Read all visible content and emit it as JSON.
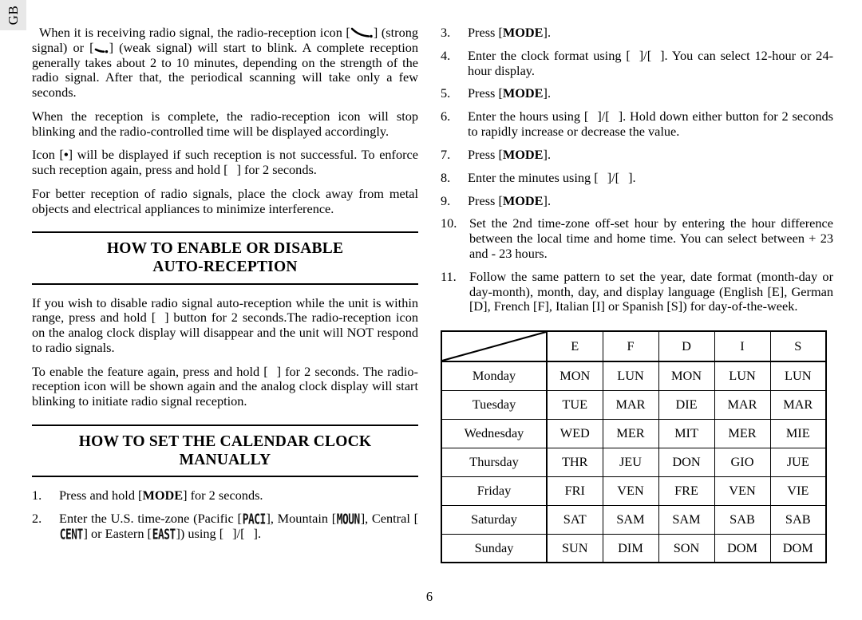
{
  "language_tab": {
    "label": "GB"
  },
  "page_number": "6",
  "left_column": {
    "paragraphs": [
      {
        "id": "p-receiving-signal",
        "segments": [
          {
            "type": "text",
            "text": "When it is receiving radio signal, the radio-reception icon ["
          },
          {
            "type": "icon",
            "name": "signal-strong-icon"
          },
          {
            "type": "text",
            "text": "] (strong signal) or ["
          },
          {
            "type": "icon",
            "name": "signal-weak-icon"
          },
          {
            "type": "text",
            "text": "] (weak signal) will start to blink. A complete reception generally takes about 2 to 10 minutes, depending on the strength of the radio signal. After that, the periodical scanning will take only a few seconds."
          }
        ]
      },
      {
        "id": "p-reception-complete",
        "segments": [
          {
            "type": "text",
            "text": "When the reception is complete, the radio-reception icon will stop blinking and the radio-controlled time will be displayed accordingly."
          }
        ]
      },
      {
        "id": "p-icon-dot",
        "segments": [
          {
            "type": "text",
            "text": "Icon ["
          },
          {
            "type": "bold",
            "text": "•"
          },
          {
            "type": "text",
            "text": "] will be displayed if such reception is not successful. To enforce such reception again, press and hold ["
          },
          {
            "type": "placeholder",
            "name": "button-placeholder"
          },
          {
            "type": "text",
            "text": "] for 2 seconds."
          }
        ]
      },
      {
        "id": "p-better-reception",
        "segments": [
          {
            "type": "text",
            "text": "For better reception of radio signals, place the clock away from metal objects and electrical appliances to minimize interference."
          }
        ]
      }
    ],
    "heading_auto_reception": {
      "line1": "HOW TO ENABLE OR DISABLE",
      "line2": "AUTO-RECEPTION"
    },
    "auto_reception_paragraphs": [
      {
        "id": "p-disable-auto",
        "segments": [
          {
            "type": "text",
            "text": "If you wish to disable radio signal  auto-reception while the unit is within range, press and hold ["
          },
          {
            "type": "placeholder",
            "name": "button-placeholder"
          },
          {
            "type": "text",
            "text": "] button for 2 seconds.The radio-reception icon on the analog clock display will disappear and the unit will NOT respond to radio signals."
          }
        ]
      },
      {
        "id": "p-enable-again",
        "segments": [
          {
            "type": "text",
            "text": "To enable the feature again, press and hold ["
          },
          {
            "type": "placeholder",
            "name": "button-placeholder"
          },
          {
            "type": "text",
            "text": "] for 2 seconds. The radio-reception icon will be shown again and the analog clock display will start blinking to initiate radio signal reception."
          }
        ]
      }
    ],
    "heading_manual_set": {
      "line1": "HOW TO SET THE CALENDAR CLOCK",
      "line2": "MANUALLY"
    },
    "steps": [
      {
        "number": "1.",
        "segments": [
          {
            "type": "text",
            "text": "Press and hold ["
          },
          {
            "type": "bold",
            "text": "MODE"
          },
          {
            "type": "text",
            "text": "] for 2 seconds."
          }
        ]
      },
      {
        "number": "2.",
        "segments": [
          {
            "type": "text",
            "text": "Enter the U.S. time-zone (Pacific ["
          },
          {
            "type": "lcd",
            "text": "PACI"
          },
          {
            "type": "text",
            "text": "], Mountain ["
          },
          {
            "type": "lcd",
            "text": "MOUN"
          },
          {
            "type": "text",
            "text": "], Central ["
          },
          {
            "type": "lcd",
            "text": "CENT"
          },
          {
            "type": "text",
            "text": "] or Eastern ["
          },
          {
            "type": "lcd",
            "text": "EAST"
          },
          {
            "type": "text",
            "text": "]) using ["
          },
          {
            "type": "placeholder",
            "name": "button-placeholder"
          },
          {
            "type": "text",
            "text": "]/["
          },
          {
            "type": "placeholder",
            "name": "button-placeholder"
          },
          {
            "type": "text",
            "text": "]."
          }
        ]
      }
    ]
  },
  "right_column": {
    "steps": [
      {
        "number": "3.",
        "segments": [
          {
            "type": "text",
            "text": "Press ["
          },
          {
            "type": "bold",
            "text": "MODE"
          },
          {
            "type": "text",
            "text": "]."
          }
        ]
      },
      {
        "number": "4.",
        "segments": [
          {
            "type": "text",
            "text": "Enter the clock format using ["
          },
          {
            "type": "placeholder",
            "name": "button-placeholder"
          },
          {
            "type": "text",
            "text": "]/["
          },
          {
            "type": "placeholder",
            "name": "button-placeholder"
          },
          {
            "type": "text",
            "text": "]. You can select 12-hour or 24-hour display."
          }
        ]
      },
      {
        "number": "5.",
        "segments": [
          {
            "type": "text",
            "text": "Press ["
          },
          {
            "type": "bold",
            "text": "MODE"
          },
          {
            "type": "text",
            "text": "]."
          }
        ]
      },
      {
        "number": "6.",
        "segments": [
          {
            "type": "text",
            "text": "Enter the hours using ["
          },
          {
            "type": "placeholder",
            "name": "button-placeholder"
          },
          {
            "type": "text",
            "text": "]/["
          },
          {
            "type": "placeholder",
            "name": "button-placeholder"
          },
          {
            "type": "text",
            "text": "]. Hold down either button for 2 seconds to rapidly increase or decrease the value."
          }
        ]
      },
      {
        "number": "7.",
        "segments": [
          {
            "type": "text",
            "text": "Press ["
          },
          {
            "type": "bold",
            "text": "MODE"
          },
          {
            "type": "text",
            "text": "]."
          }
        ]
      },
      {
        "number": "8.",
        "segments": [
          {
            "type": "text",
            "text": "Enter the minutes using ["
          },
          {
            "type": "placeholder",
            "name": "button-placeholder"
          },
          {
            "type": "text",
            "text": "]/["
          },
          {
            "type": "placeholder",
            "name": "button-placeholder"
          },
          {
            "type": "text",
            "text": "]."
          }
        ]
      },
      {
        "number": "9.",
        "segments": [
          {
            "type": "text",
            "text": "Press ["
          },
          {
            "type": "bold",
            "text": "MODE"
          },
          {
            "type": "text",
            "text": "]."
          }
        ]
      },
      {
        "number": "10.",
        "wide": true,
        "segments": [
          {
            "type": "text",
            "text": "Set the 2nd time-zone off-set hour by entering the hour difference between the local time and home time. You can select between + 23 and - 23 hours."
          }
        ]
      },
      {
        "number": "11.",
        "wide": true,
        "segments": [
          {
            "type": "text",
            "text": "Follow the same pattern to set the year, date format  (month-day or day-month), month, day, and display language (English [E], German [D], French [F], Italian [I] or Spanish [S]) for day-of-the-week."
          }
        ]
      }
    ],
    "day_table": {
      "corner_label": "",
      "columns": [
        "E",
        "F",
        "D",
        "I",
        "S"
      ],
      "rows": [
        {
          "day": "Monday",
          "values": [
            "MON",
            "LUN",
            "MON",
            "LUN",
            "LUN"
          ]
        },
        {
          "day": "Tuesday",
          "values": [
            "TUE",
            "MAR",
            "DIE",
            "MAR",
            "MAR"
          ]
        },
        {
          "day": "Wednesday",
          "values": [
            "WED",
            "MER",
            "MIT",
            "MER",
            "MIE"
          ]
        },
        {
          "day": "Thursday",
          "values": [
            "THR",
            "JEU",
            "DON",
            "GIO",
            "JUE"
          ]
        },
        {
          "day": "Friday",
          "values": [
            "FRI",
            "VEN",
            "FRE",
            "VEN",
            "VIE"
          ]
        },
        {
          "day": "Saturday",
          "values": [
            "SAT",
            "SAM",
            "SAM",
            "SAB",
            "SAB"
          ]
        },
        {
          "day": "Sunday",
          "values": [
            "SUN",
            "DIM",
            "SON",
            "DOM",
            "DOM"
          ]
        }
      ]
    }
  }
}
